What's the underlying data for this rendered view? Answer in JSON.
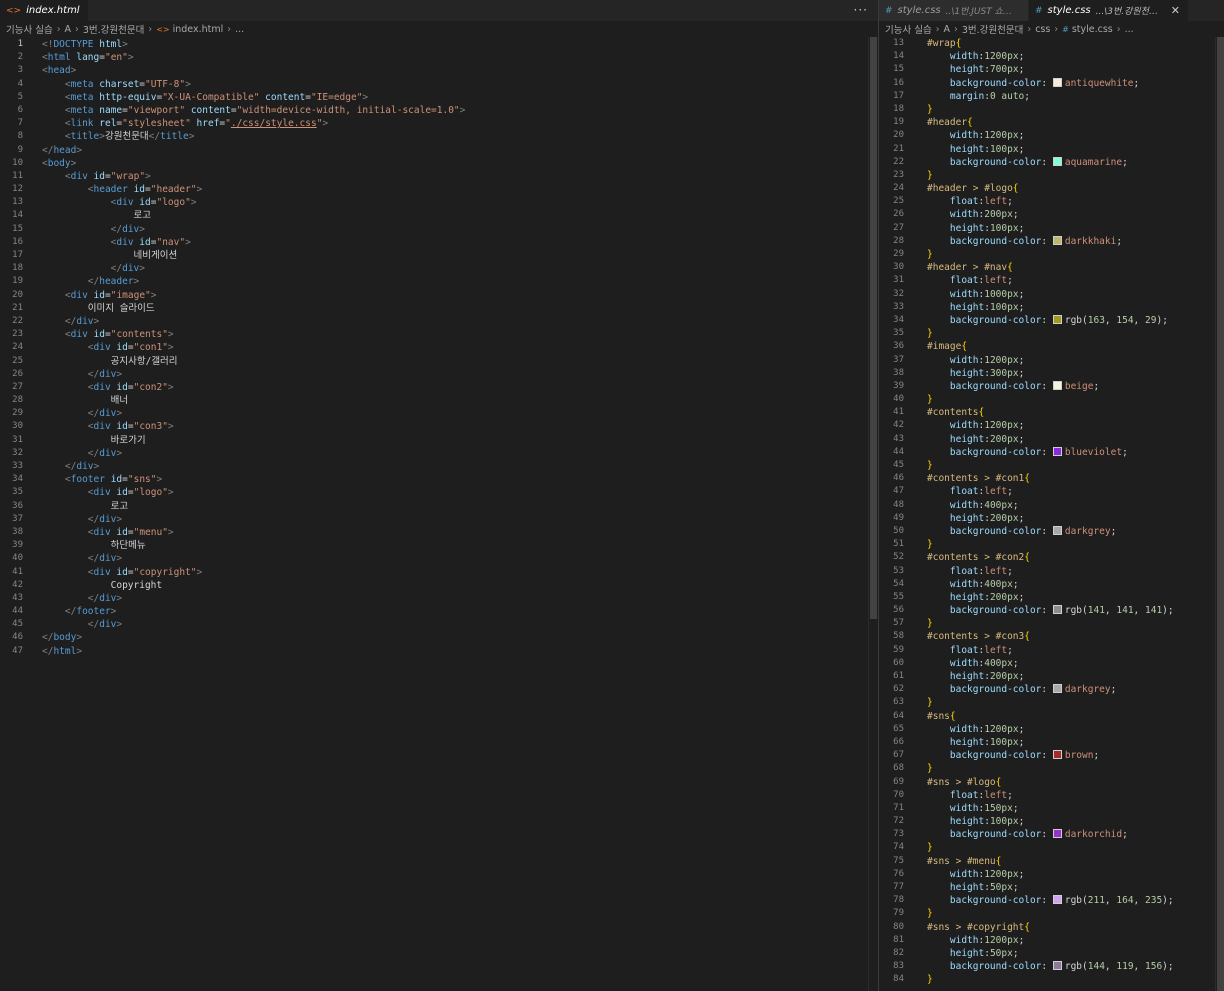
{
  "left": {
    "tab": {
      "icon": "<>",
      "label": "index.html"
    },
    "more": "···",
    "breadcrumb": [
      "기능사 실습",
      "A",
      "3번.강원천문대",
      "index.html",
      "..."
    ]
  },
  "right": {
    "tabs": [
      {
        "icon": "#",
        "label": "style.css",
        "desc": "..\\1번.JUST 쇼핑몰\\...",
        "active": false
      },
      {
        "icon": "#",
        "label": "style.css",
        "desc": "...\\3번.강원천문대\\...",
        "active": true
      }
    ],
    "close": "✕",
    "breadcrumb": [
      "기능사 실습",
      "A",
      "3번.강원천문대",
      "css",
      "style.css",
      "..."
    ]
  },
  "html_lines": [
    [
      [
        "t-pun",
        "<!"
      ],
      [
        "t-tag",
        "DOCTYPE"
      ],
      [
        "t-txt",
        " "
      ],
      [
        "t-att",
        "html"
      ],
      [
        "t-pun",
        ">"
      ]
    ],
    [
      [
        "t-pun",
        "<"
      ],
      [
        "t-tag",
        "html"
      ],
      [
        "t-txt",
        " "
      ],
      [
        "t-att",
        "lang"
      ],
      [
        "t-txt",
        "="
      ],
      [
        "t-str",
        "\"en\""
      ],
      [
        "t-pun",
        ">"
      ]
    ],
    [
      [
        "t-pun",
        "<"
      ],
      [
        "t-tag",
        "head"
      ],
      [
        "t-pun",
        ">"
      ]
    ],
    [
      [
        "t-txt",
        "    "
      ],
      [
        "t-pun",
        "<"
      ],
      [
        "t-tag",
        "meta"
      ],
      [
        "t-txt",
        " "
      ],
      [
        "t-att",
        "charset"
      ],
      [
        "t-txt",
        "="
      ],
      [
        "t-str",
        "\"UTF-8\""
      ],
      [
        "t-pun",
        ">"
      ]
    ],
    [
      [
        "t-txt",
        "    "
      ],
      [
        "t-pun",
        "<"
      ],
      [
        "t-tag",
        "meta"
      ],
      [
        "t-txt",
        " "
      ],
      [
        "t-att",
        "http-equiv"
      ],
      [
        "t-txt",
        "="
      ],
      [
        "t-str",
        "\"X-UA-Compatible\""
      ],
      [
        "t-txt",
        " "
      ],
      [
        "t-att",
        "content"
      ],
      [
        "t-txt",
        "="
      ],
      [
        "t-str",
        "\"IE=edge\""
      ],
      [
        "t-pun",
        ">"
      ]
    ],
    [
      [
        "t-txt",
        "    "
      ],
      [
        "t-pun",
        "<"
      ],
      [
        "t-tag",
        "meta"
      ],
      [
        "t-txt",
        " "
      ],
      [
        "t-att",
        "name"
      ],
      [
        "t-txt",
        "="
      ],
      [
        "t-str",
        "\"viewport\""
      ],
      [
        "t-txt",
        " "
      ],
      [
        "t-att",
        "content"
      ],
      [
        "t-txt",
        "="
      ],
      [
        "t-str",
        "\"width=device-width, initial-scale=1.0\""
      ],
      [
        "t-pun",
        ">"
      ]
    ],
    [
      [
        "t-txt",
        "    "
      ],
      [
        "t-pun",
        "<"
      ],
      [
        "t-tag",
        "link"
      ],
      [
        "t-txt",
        " "
      ],
      [
        "t-att",
        "rel"
      ],
      [
        "t-txt",
        "="
      ],
      [
        "t-str",
        "\"stylesheet\""
      ],
      [
        "t-txt",
        " "
      ],
      [
        "t-att",
        "href"
      ],
      [
        "t-txt",
        "="
      ],
      [
        "t-str",
        "\""
      ],
      [
        "t-str u",
        "./css/style.css"
      ],
      [
        "t-str",
        "\""
      ],
      [
        "t-pun",
        ">"
      ]
    ],
    [
      [
        "t-txt",
        "    "
      ],
      [
        "t-pun",
        "<"
      ],
      [
        "t-tag",
        "title"
      ],
      [
        "t-pun",
        ">"
      ],
      [
        "t-txt",
        "강원천문대"
      ],
      [
        "t-pun",
        "</"
      ],
      [
        "t-tag",
        "title"
      ],
      [
        "t-pun",
        ">"
      ]
    ],
    [
      [
        "t-pun",
        "</"
      ],
      [
        "t-tag",
        "head"
      ],
      [
        "t-pun",
        ">"
      ]
    ],
    [
      [
        "t-pun",
        "<"
      ],
      [
        "t-tag",
        "body"
      ],
      [
        "t-pun",
        ">"
      ]
    ],
    [
      [
        "t-txt",
        "    "
      ],
      [
        "t-pun",
        "<"
      ],
      [
        "t-tag",
        "div"
      ],
      [
        "t-txt",
        " "
      ],
      [
        "t-att",
        "id"
      ],
      [
        "t-txt",
        "="
      ],
      [
        "t-str",
        "\"wrap\""
      ],
      [
        "t-pun",
        ">"
      ]
    ],
    [
      [
        "t-txt",
        "        "
      ],
      [
        "t-pun",
        "<"
      ],
      [
        "t-tag",
        "header"
      ],
      [
        "t-txt",
        " "
      ],
      [
        "t-att",
        "id"
      ],
      [
        "t-txt",
        "="
      ],
      [
        "t-str",
        "\"header\""
      ],
      [
        "t-pun",
        ">"
      ]
    ],
    [
      [
        "t-txt",
        "            "
      ],
      [
        "t-pun",
        "<"
      ],
      [
        "t-tag",
        "div"
      ],
      [
        "t-txt",
        " "
      ],
      [
        "t-att",
        "id"
      ],
      [
        "t-txt",
        "="
      ],
      [
        "t-str",
        "\"logo\""
      ],
      [
        "t-pun",
        ">"
      ]
    ],
    [
      [
        "t-txt",
        "                로고"
      ]
    ],
    [
      [
        "t-txt",
        "            "
      ],
      [
        "t-pun",
        "</"
      ],
      [
        "t-tag",
        "div"
      ],
      [
        "t-pun",
        ">"
      ]
    ],
    [
      [
        "t-txt",
        "            "
      ],
      [
        "t-pun",
        "<"
      ],
      [
        "t-tag",
        "div"
      ],
      [
        "t-txt",
        " "
      ],
      [
        "t-att",
        "id"
      ],
      [
        "t-txt",
        "="
      ],
      [
        "t-str",
        "\"nav\""
      ],
      [
        "t-pun",
        ">"
      ]
    ],
    [
      [
        "t-txt",
        "                네비게이션"
      ]
    ],
    [
      [
        "t-txt",
        "            "
      ],
      [
        "t-pun",
        "</"
      ],
      [
        "t-tag",
        "div"
      ],
      [
        "t-pun",
        ">"
      ]
    ],
    [
      [
        "t-txt",
        "        "
      ],
      [
        "t-pun",
        "</"
      ],
      [
        "t-tag",
        "header"
      ],
      [
        "t-pun",
        ">"
      ]
    ],
    [
      [
        "t-txt",
        "    "
      ],
      [
        "t-pun",
        "<"
      ],
      [
        "t-tag",
        "div"
      ],
      [
        "t-txt",
        " "
      ],
      [
        "t-att",
        "id"
      ],
      [
        "t-txt",
        "="
      ],
      [
        "t-str",
        "\"image\""
      ],
      [
        "t-pun",
        ">"
      ]
    ],
    [
      [
        "t-txt",
        "        이미지 슬라이드"
      ]
    ],
    [
      [
        "t-txt",
        "    "
      ],
      [
        "t-pun",
        "</"
      ],
      [
        "t-tag",
        "div"
      ],
      [
        "t-pun",
        ">"
      ]
    ],
    [
      [
        "t-txt",
        "    "
      ],
      [
        "t-pun",
        "<"
      ],
      [
        "t-tag",
        "div"
      ],
      [
        "t-txt",
        " "
      ],
      [
        "t-att",
        "id"
      ],
      [
        "t-txt",
        "="
      ],
      [
        "t-str",
        "\"contents\""
      ],
      [
        "t-pun",
        ">"
      ]
    ],
    [
      [
        "t-txt",
        "        "
      ],
      [
        "t-pun",
        "<"
      ],
      [
        "t-tag",
        "div"
      ],
      [
        "t-txt",
        " "
      ],
      [
        "t-att",
        "id"
      ],
      [
        "t-txt",
        "="
      ],
      [
        "t-str",
        "\"con1\""
      ],
      [
        "t-pun",
        ">"
      ]
    ],
    [
      [
        "t-txt",
        "            공지사항/갤러리"
      ]
    ],
    [
      [
        "t-txt",
        "        "
      ],
      [
        "t-pun",
        "</"
      ],
      [
        "t-tag",
        "div"
      ],
      [
        "t-pun",
        ">"
      ]
    ],
    [
      [
        "t-txt",
        "        "
      ],
      [
        "t-pun",
        "<"
      ],
      [
        "t-tag",
        "div"
      ],
      [
        "t-txt",
        " "
      ],
      [
        "t-att",
        "id"
      ],
      [
        "t-txt",
        "="
      ],
      [
        "t-str",
        "\"con2\""
      ],
      [
        "t-pun",
        ">"
      ]
    ],
    [
      [
        "t-txt",
        "            배너"
      ]
    ],
    [
      [
        "t-txt",
        "        "
      ],
      [
        "t-pun",
        "</"
      ],
      [
        "t-tag",
        "div"
      ],
      [
        "t-pun",
        ">"
      ]
    ],
    [
      [
        "t-txt",
        "        "
      ],
      [
        "t-pun",
        "<"
      ],
      [
        "t-tag",
        "div"
      ],
      [
        "t-txt",
        " "
      ],
      [
        "t-att",
        "id"
      ],
      [
        "t-txt",
        "="
      ],
      [
        "t-str",
        "\"con3\""
      ],
      [
        "t-pun",
        ">"
      ]
    ],
    [
      [
        "t-txt",
        "            바로가기"
      ]
    ],
    [
      [
        "t-txt",
        "        "
      ],
      [
        "t-pun",
        "</"
      ],
      [
        "t-tag",
        "div"
      ],
      [
        "t-pun",
        ">"
      ]
    ],
    [
      [
        "t-txt",
        "    "
      ],
      [
        "t-pun",
        "</"
      ],
      [
        "t-tag",
        "div"
      ],
      [
        "t-pun",
        ">"
      ]
    ],
    [
      [
        "t-txt",
        "    "
      ],
      [
        "t-pun",
        "<"
      ],
      [
        "t-tag",
        "footer"
      ],
      [
        "t-txt",
        " "
      ],
      [
        "t-att",
        "id"
      ],
      [
        "t-txt",
        "="
      ],
      [
        "t-str",
        "\"sns\""
      ],
      [
        "t-pun",
        ">"
      ]
    ],
    [
      [
        "t-txt",
        "        "
      ],
      [
        "t-pun",
        "<"
      ],
      [
        "t-tag",
        "div"
      ],
      [
        "t-txt",
        " "
      ],
      [
        "t-att",
        "id"
      ],
      [
        "t-txt",
        "="
      ],
      [
        "t-str",
        "\"logo\""
      ],
      [
        "t-pun",
        ">"
      ]
    ],
    [
      [
        "t-txt",
        "            로고"
      ]
    ],
    [
      [
        "t-txt",
        "        "
      ],
      [
        "t-pun",
        "</"
      ],
      [
        "t-tag",
        "div"
      ],
      [
        "t-pun",
        ">"
      ]
    ],
    [
      [
        "t-txt",
        "        "
      ],
      [
        "t-pun",
        "<"
      ],
      [
        "t-tag",
        "div"
      ],
      [
        "t-txt",
        " "
      ],
      [
        "t-att",
        "id"
      ],
      [
        "t-txt",
        "="
      ],
      [
        "t-str",
        "\"menu\""
      ],
      [
        "t-pun",
        ">"
      ]
    ],
    [
      [
        "t-txt",
        "            하단메뉴"
      ]
    ],
    [
      [
        "t-txt",
        "        "
      ],
      [
        "t-pun",
        "</"
      ],
      [
        "t-tag",
        "div"
      ],
      [
        "t-pun",
        ">"
      ]
    ],
    [
      [
        "t-txt",
        "        "
      ],
      [
        "t-pun",
        "<"
      ],
      [
        "t-tag",
        "div"
      ],
      [
        "t-txt",
        " "
      ],
      [
        "t-att",
        "id"
      ],
      [
        "t-txt",
        "="
      ],
      [
        "t-str",
        "\"copyright\""
      ],
      [
        "t-pun",
        ">"
      ]
    ],
    [
      [
        "t-txt",
        "            Copyright"
      ]
    ],
    [
      [
        "t-txt",
        "        "
      ],
      [
        "t-pun",
        "</"
      ],
      [
        "t-tag",
        "div"
      ],
      [
        "t-pun",
        ">"
      ]
    ],
    [
      [
        "t-txt",
        "    "
      ],
      [
        "t-pun",
        "</"
      ],
      [
        "t-tag",
        "footer"
      ],
      [
        "t-pun",
        ">"
      ]
    ],
    [
      [
        "t-txt",
        "        "
      ],
      [
        "t-pun",
        "</"
      ],
      [
        "t-tag",
        "div"
      ],
      [
        "t-pun",
        ">"
      ]
    ],
    [
      [
        "t-pun",
        "</"
      ],
      [
        "t-tag",
        "body"
      ],
      [
        "t-pun",
        ">"
      ]
    ],
    [
      [
        "t-pun",
        "</"
      ],
      [
        "t-tag",
        "html"
      ],
      [
        "t-pun",
        ">"
      ]
    ]
  ],
  "css_start_line": 13,
  "css_lines": [
    {
      "sel": "#wrap{"
    },
    {
      "p": "width",
      "n": "1200",
      "u": "px"
    },
    {
      "p": "height",
      "n": "700",
      "u": "px"
    },
    {
      "p": "background-color",
      "c": "#faebd7",
      "v": "antiquewhite"
    },
    {
      "p": "margin",
      "raw": "0 auto"
    },
    {
      "end": true
    },
    {
      "sel": "#header{"
    },
    {
      "p": "width",
      "n": "1200",
      "u": "px"
    },
    {
      "p": "height",
      "n": "100",
      "u": "px"
    },
    {
      "p": "background-color",
      "c": "#7fffd4",
      "v": "aquamarine"
    },
    {
      "end": true
    },
    {
      "sel": "#header > #logo{"
    },
    {
      "p": "float",
      "v": "left"
    },
    {
      "p": "width",
      "n": "200",
      "u": "px"
    },
    {
      "p": "height",
      "n": "100",
      "u": "px"
    },
    {
      "p": "background-color",
      "c": "#bdb76b",
      "v": "darkkhaki"
    },
    {
      "end": true
    },
    {
      "sel": "#header > #nav{"
    },
    {
      "p": "float",
      "v": "left"
    },
    {
      "p": "width",
      "n": "1000",
      "u": "px"
    },
    {
      "p": "height",
      "n": "100",
      "u": "px"
    },
    {
      "p": "background-color",
      "c": "#a39a1d",
      "rgb": [
        "163",
        "154",
        "29"
      ]
    },
    {
      "end": true
    },
    {
      "sel": "#image{"
    },
    {
      "p": "width",
      "n": "1200",
      "u": "px"
    },
    {
      "p": "height",
      "n": "300",
      "u": "px"
    },
    {
      "p": "background-color",
      "c": "#f5f5dc",
      "v": "beige"
    },
    {
      "end": true
    },
    {
      "sel": "#contents{"
    },
    {
      "p": "width",
      "n": "1200",
      "u": "px"
    },
    {
      "p": "height",
      "n": "200",
      "u": "px"
    },
    {
      "p": "background-color",
      "c": "#8a2be2",
      "v": "blueviolet"
    },
    {
      "end": true
    },
    {
      "sel": "#contents > #con1{"
    },
    {
      "p": "float",
      "v": "left"
    },
    {
      "p": "width",
      "n": "400",
      "u": "px"
    },
    {
      "p": "height",
      "n": "200",
      "u": "px"
    },
    {
      "p": "background-color",
      "c": "#a9a9a9",
      "v": "darkgrey"
    },
    {
      "end": true
    },
    {
      "sel": "#contents > #con2{"
    },
    {
      "p": "float",
      "v": "left"
    },
    {
      "p": "width",
      "n": "400",
      "u": "px"
    },
    {
      "p": "height",
      "n": "200",
      "u": "px"
    },
    {
      "p": "background-color",
      "c": "#8d8d8d",
      "rgb": [
        "141",
        "141",
        "141"
      ]
    },
    {
      "end": true
    },
    {
      "sel": "#contents > #con3{"
    },
    {
      "p": "float",
      "v": "left"
    },
    {
      "p": "width",
      "n": "400",
      "u": "px"
    },
    {
      "p": "height",
      "n": "200",
      "u": "px"
    },
    {
      "p": "background-color",
      "c": "#a9a9a9",
      "v": "darkgrey"
    },
    {
      "end": true
    },
    {
      "sel": "#sns{"
    },
    {
      "p": "width",
      "n": "1200",
      "u": "px"
    },
    {
      "p": "height",
      "n": "100",
      "u": "px"
    },
    {
      "p": "background-color",
      "c": "#a52a2a",
      "v": "brown"
    },
    {
      "end": true
    },
    {
      "sel": "#sns > #logo{"
    },
    {
      "p": "float",
      "v": "left"
    },
    {
      "p": "width",
      "n": "150",
      "u": "px"
    },
    {
      "p": "height",
      "n": "100",
      "u": "px"
    },
    {
      "p": "background-color",
      "c": "#9932cc",
      "v": "darkorchid"
    },
    {
      "end": true
    },
    {
      "sel": "#sns > #menu{"
    },
    {
      "p": "width",
      "n": "1200",
      "u": "px"
    },
    {
      "p": "height",
      "n": "50",
      "u": "px"
    },
    {
      "p": "background-color",
      "c": "#d3a4eb",
      "rgb": [
        "211",
        "164",
        "235"
      ]
    },
    {
      "end": true
    },
    {
      "sel": "#sns > #copyright{"
    },
    {
      "p": "width",
      "n": "1200",
      "u": "px"
    },
    {
      "p": "height",
      "n": "50",
      "u": "px"
    },
    {
      "p": "background-color",
      "c": "#90779c",
      "rgb": [
        "144",
        "119",
        "156"
      ]
    },
    {
      "end": true
    }
  ]
}
